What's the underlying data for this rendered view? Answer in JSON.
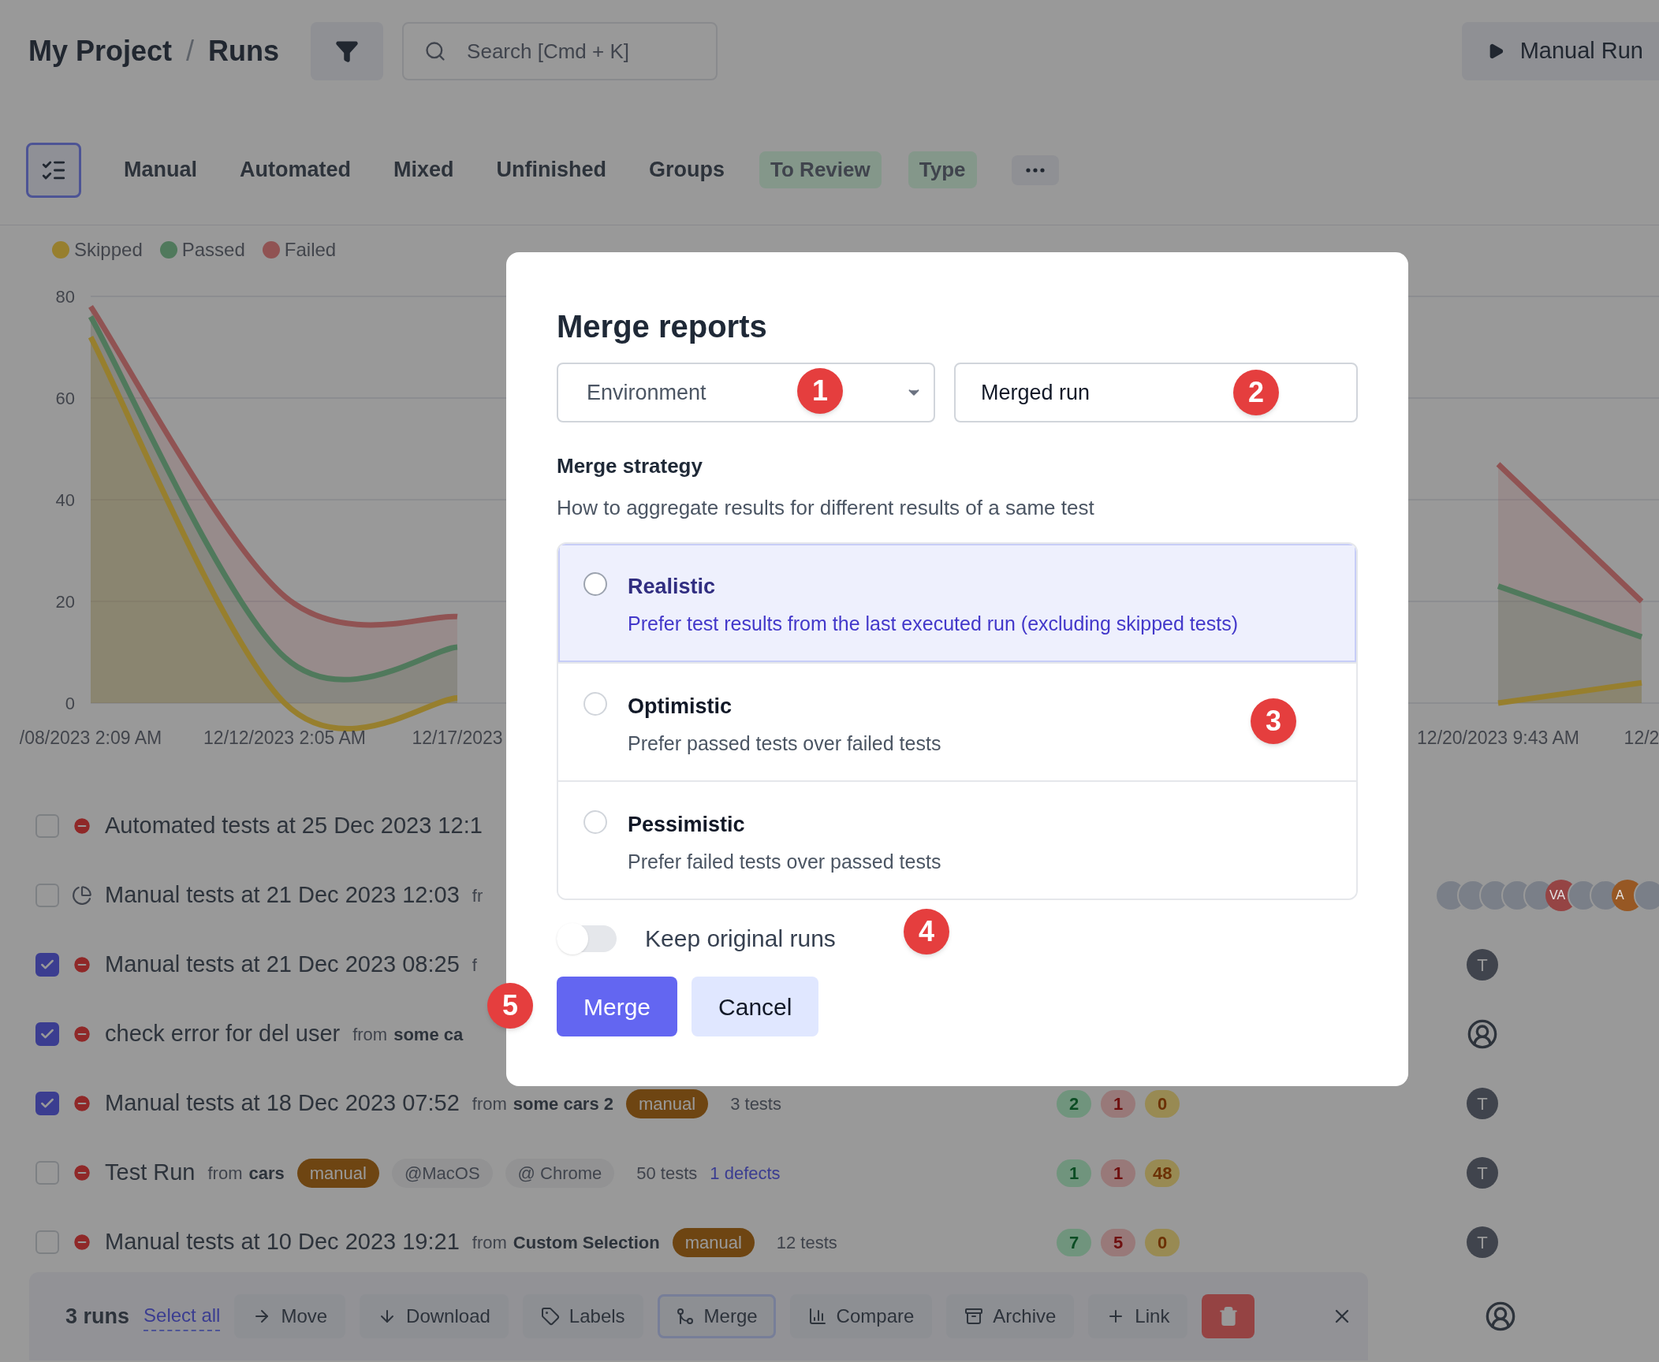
{
  "header": {
    "breadcrumb": [
      {
        "label": "My Project"
      },
      {
        "label": "Runs"
      }
    ],
    "separator": "/",
    "search": {
      "placeholder": "Search [Cmd + K]"
    },
    "run_button": {
      "label": "Manual Run"
    }
  },
  "tabs": [
    {
      "label": "Manual",
      "kind": "plain"
    },
    {
      "label": "Automated",
      "kind": "plain"
    },
    {
      "label": "Mixed",
      "kind": "plain"
    },
    {
      "label": "Unfinished",
      "kind": "plain"
    },
    {
      "label": "Groups",
      "kind": "plain"
    },
    {
      "label": "To Review",
      "kind": "badge"
    },
    {
      "label": "Type",
      "kind": "badge"
    }
  ],
  "chart_data": {
    "type": "area",
    "grid": true,
    "categories": [
      "/08/2023 2:09 AM",
      "12/12/2023 2:05 AM",
      "12/17/2023",
      null,
      null,
      null,
      null,
      "12/20/2023 9:43 AM",
      "12/2"
    ],
    "ylim": [
      0,
      80
    ],
    "yticks": [
      0,
      20,
      40,
      60,
      80
    ],
    "series": [
      {
        "name": "Skipped",
        "color": "#977f2e",
        "values": [
          72,
          0,
          1,
          null,
          null,
          null,
          null,
          0,
          4
        ]
      },
      {
        "name": "Passed",
        "color": "#50795c",
        "values": [
          76,
          9,
          11,
          null,
          null,
          null,
          null,
          23,
          13
        ]
      },
      {
        "name": "Failed",
        "color": "#905353",
        "values": [
          78,
          21,
          17,
          null,
          null,
          null,
          null,
          47,
          20
        ]
      }
    ]
  },
  "runs": [
    {
      "title": "Automated tests at 25 Dec 2023 12:1",
      "checked": false,
      "kind": "failed"
    },
    {
      "title": "Manual tests at 21 Dec 2023 12:03",
      "checked": false,
      "kind": "in_progress",
      "source_prefix": "fr",
      "avatars": [
        {
          "kind": "photo"
        },
        {
          "kind": "photo"
        },
        {
          "kind": "photo"
        },
        {
          "kind": "photo"
        },
        {
          "kind": "photo"
        },
        {
          "kind": "initials",
          "text": "VA",
          "color": "#954444"
        },
        {
          "kind": "photo"
        },
        {
          "kind": "photo"
        },
        {
          "kind": "initials",
          "text": "A",
          "color": "#975824"
        },
        {
          "kind": "photo"
        }
      ]
    },
    {
      "title": "Manual tests at 21 Dec 2023 08:25",
      "checked": true,
      "kind": "failed",
      "source_prefix": "f",
      "assignee": {
        "kind": "initials",
        "text": "T"
      }
    },
    {
      "title": "check error for del user",
      "checked": true,
      "kind": "failed",
      "source_prefix": "from",
      "source": "some ca",
      "assignee": {
        "kind": "user"
      }
    },
    {
      "title": "Manual tests at 18 Dec 2023 07:52",
      "checked": true,
      "kind": "failed",
      "source_prefix": "from",
      "source": "some cars 2",
      "labels": [
        {
          "text": "manual",
          "kind": "type"
        }
      ],
      "tests": "3 tests",
      "counts": [
        {
          "kind": "passed",
          "value": "2"
        },
        {
          "kind": "failed",
          "value": "1"
        },
        {
          "kind": "skipped",
          "value": "0"
        }
      ],
      "assignee": {
        "kind": "initials",
        "text": "T"
      }
    },
    {
      "title": "Test Run",
      "checked": false,
      "kind": "failed",
      "source_prefix": "from",
      "source": "cars",
      "labels": [
        {
          "text": "manual",
          "kind": "type"
        },
        {
          "text": "@MacOS",
          "kind": "env"
        },
        {
          "text": "@ Chrome",
          "kind": "env"
        }
      ],
      "tests": "50 tests",
      "defects": "1 defects",
      "counts": [
        {
          "kind": "passed",
          "value": "1"
        },
        {
          "kind": "failed",
          "value": "1"
        },
        {
          "kind": "skipped",
          "value": "48"
        }
      ],
      "assignee": {
        "kind": "initials",
        "text": "T"
      }
    },
    {
      "title": "Manual tests at 10 Dec 2023 19:21",
      "checked": false,
      "kind": "failed",
      "source_prefix": "from",
      "source": "Custom Selection",
      "labels": [
        {
          "text": "manual",
          "kind": "type"
        }
      ],
      "tests": "12 tests",
      "counts": [
        {
          "kind": "passed",
          "value": "7"
        },
        {
          "kind": "failed",
          "value": "5"
        },
        {
          "kind": "skipped",
          "value": "0"
        }
      ],
      "assignee": {
        "kind": "initials",
        "text": "T"
      }
    }
  ],
  "toolbar": {
    "count": "3 runs",
    "select_all": "Select all",
    "actions": [
      {
        "label": "Move",
        "selected": false
      },
      {
        "label": "Download",
        "selected": false
      },
      {
        "label": "Labels",
        "selected": false
      },
      {
        "label": "Merge",
        "selected": true
      },
      {
        "label": "Compare",
        "selected": false
      },
      {
        "label": "Archive",
        "selected": false
      },
      {
        "label": "Link",
        "selected": false
      }
    ]
  },
  "modal": {
    "title": "Merge reports",
    "group_by": {
      "value": "Environment"
    },
    "name": {
      "value": "Merged run"
    },
    "strategy_label": "Merge strategy",
    "strategy_hint": "How to aggregate results for different results of a same test",
    "strategies": [
      {
        "title": "Realistic",
        "description": "Prefer test results from the last executed run (excluding skipped tests)",
        "selected": true
      },
      {
        "title": "Optimistic",
        "description": "Prefer passed tests over failed tests",
        "selected": false
      },
      {
        "title": "Pessimistic",
        "description": "Prefer failed tests over passed tests",
        "selected": false
      }
    ],
    "keep_original": {
      "label": "Keep original runs",
      "on": false
    },
    "buttons": [
      {
        "label": "Merge",
        "kind": "primary"
      },
      {
        "label": "Cancel",
        "kind": "secondary"
      }
    ]
  },
  "markers": [
    "1",
    "2",
    "3",
    "4",
    "5"
  ]
}
